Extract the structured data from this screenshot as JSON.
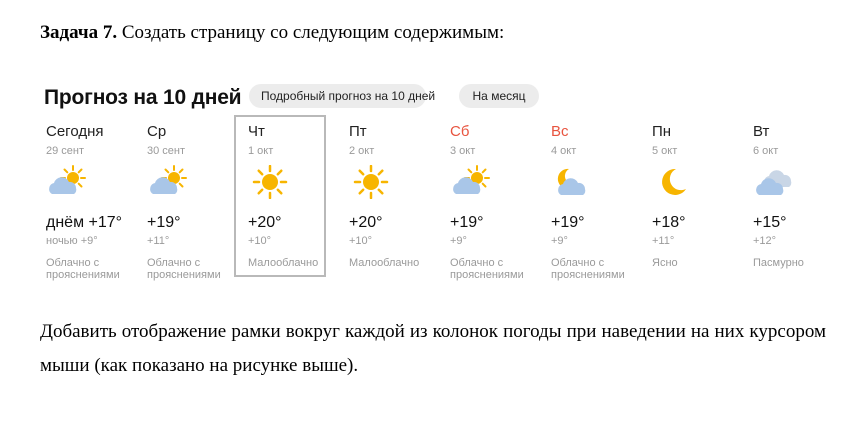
{
  "task": {
    "label": "Задача 7.",
    "text": "Создать страницу со следующим содержимым:"
  },
  "widget": {
    "title": "Прогноз на 10 дней",
    "btn_detailed": "Подробный прогноз на 10 дней",
    "btn_month": "На месяц"
  },
  "days": [
    {
      "name": "Сегодня",
      "date": "29 сент",
      "icon": "partly-cloudy-icon",
      "t_day": "днём +17°",
      "t_night": "ночью +9°",
      "condition": "Облачно с прояснениями",
      "weekend": false,
      "hovered": false
    },
    {
      "name": "Ср",
      "date": "30 сент",
      "icon": "partly-cloudy-icon",
      "t_day": "+19°",
      "t_night": "+11°",
      "condition": "Облачно с прояснениями",
      "weekend": false,
      "hovered": false
    },
    {
      "name": "Чт",
      "date": "1 окт",
      "icon": "sun-icon",
      "t_day": "+20°",
      "t_night": "+10°",
      "condition": "Малооблачно",
      "weekend": false,
      "hovered": true
    },
    {
      "name": "Пт",
      "date": "2 окт",
      "icon": "sun-icon",
      "t_day": "+20°",
      "t_night": "+10°",
      "condition": "Малооблачно",
      "weekend": false,
      "hovered": false
    },
    {
      "name": "Сб",
      "date": "3 окт",
      "icon": "partly-cloudy-icon",
      "t_day": "+19°",
      "t_night": "+9°",
      "condition": "Облачно с прояснениями",
      "weekend": true,
      "hovered": false
    },
    {
      "name": "Вс",
      "date": "4 окт",
      "icon": "moon-cloud-icon",
      "t_day": "+19°",
      "t_night": "+9°",
      "condition": "Облачно с прояснениями",
      "weekend": true,
      "hovered": false
    },
    {
      "name": "Пн",
      "date": "5 окт",
      "icon": "moon-icon",
      "t_day": "+18°",
      "t_night": "+11°",
      "condition": "Ясно",
      "weekend": false,
      "hovered": false
    },
    {
      "name": "Вт",
      "date": "6 окт",
      "icon": "overcast-icon",
      "t_day": "+15°",
      "t_night": "+12°",
      "condition": "Пасмурно",
      "weekend": false,
      "hovered": false
    }
  ],
  "colors": {
    "accent_weekend": "#e8543f",
    "sun": "#f7b500",
    "cloud": "#a9c6e8",
    "hover_border": "#b9b9b9"
  },
  "paragraph": "Добавить отображение рамки вокруг каждой из колонок погоды при наведении на них курсором мыши (как показано на рисунке выше)."
}
